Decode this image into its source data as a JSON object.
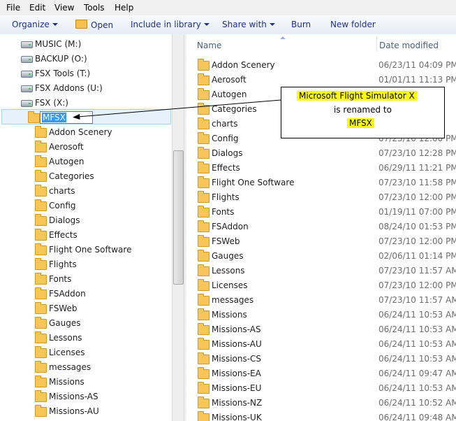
{
  "menubar": {
    "items": [
      "File",
      "Edit",
      "View",
      "Tools",
      "Help"
    ]
  },
  "toolbar": {
    "organize": "Organize",
    "open": "Open",
    "include_in_library": "Include in library",
    "share_with": "Share with",
    "burn": "Burn",
    "new_folder": "New folder"
  },
  "nav": {
    "drives": [
      {
        "label": "MUSIC (M:)",
        "icon": "drive-icon"
      },
      {
        "label": "BACKUP (O:)",
        "icon": "drive-icon"
      },
      {
        "label": "FSX Tools (T:)",
        "icon": "drive-icon"
      },
      {
        "label": "FSX Addons (U:)",
        "icon": "drive-icon"
      },
      {
        "label": "FSX (X:)",
        "icon": "drive-icon"
      }
    ],
    "rename_value": "MFSX",
    "folders": [
      "Addon Scenery",
      "Aerosoft",
      "Autogen",
      "Categories",
      "charts",
      "Config",
      "Dialogs",
      "Effects",
      "Flight One Software",
      "Flights",
      "Fonts",
      "FSAddon",
      "FSWeb",
      "Gauges",
      "Lessons",
      "Licenses",
      "messages",
      "Missions",
      "Missions-AS",
      "Missions-AU"
    ]
  },
  "list": {
    "col_name": "Name",
    "col_date": "Date modified",
    "rows": [
      {
        "name": "Addon Scenery",
        "date": "06/23/11 04:09 PM"
      },
      {
        "name": "Aerosoft",
        "date": "01/01/11 11:13 PM"
      },
      {
        "name": "Autogen",
        "date": ""
      },
      {
        "name": "Categories",
        "date": ""
      },
      {
        "name": "charts",
        "date": ""
      },
      {
        "name": "Config",
        "date": "07/23/10 12:00 PM"
      },
      {
        "name": "Dialogs",
        "date": "07/23/10 12:28 PM"
      },
      {
        "name": "Effects",
        "date": "06/29/11 11:21 PM"
      },
      {
        "name": "Flight One Software",
        "date": "07/23/10 11:58 PM"
      },
      {
        "name": "Flights",
        "date": "07/23/10 12:00 PM"
      },
      {
        "name": "Fonts",
        "date": "01/19/11 07:00 PM"
      },
      {
        "name": "FSAddon",
        "date": "08/24/10 01:53 PM"
      },
      {
        "name": "FSWeb",
        "date": "07/23/10 12:00 PM"
      },
      {
        "name": "Gauges",
        "date": "02/06/11 01:14 PM"
      },
      {
        "name": "Lessons",
        "date": "07/23/10 11:57 AM"
      },
      {
        "name": "Licenses",
        "date": "07/23/10 12:00 PM"
      },
      {
        "name": "messages",
        "date": "07/23/10 11:57 AM"
      },
      {
        "name": "Missions",
        "date": "06/24/11 10:53 AM"
      },
      {
        "name": "Missions-AS",
        "date": "06/24/11 10:53 AM"
      },
      {
        "name": "Missions-AU",
        "date": "06/24/11 10:53 AM"
      },
      {
        "name": "Missions-CS",
        "date": "06/24/11 10:53 AM"
      },
      {
        "name": "Missions-EA",
        "date": "06/24/11 09:47 AM"
      },
      {
        "name": "Missions-EU",
        "date": "06/24/11 10:53 AM"
      },
      {
        "name": "Missions-NZ",
        "date": "06/24/11 10:52 AM"
      },
      {
        "name": "Missions-UK",
        "date": "06/24/11 09:48 AM"
      }
    ]
  },
  "callout": {
    "line1": "Microsoft Flight Simulator X",
    "line2": "is renamed to",
    "line3": "MFSX",
    "highlight_color": "#ffff00"
  }
}
